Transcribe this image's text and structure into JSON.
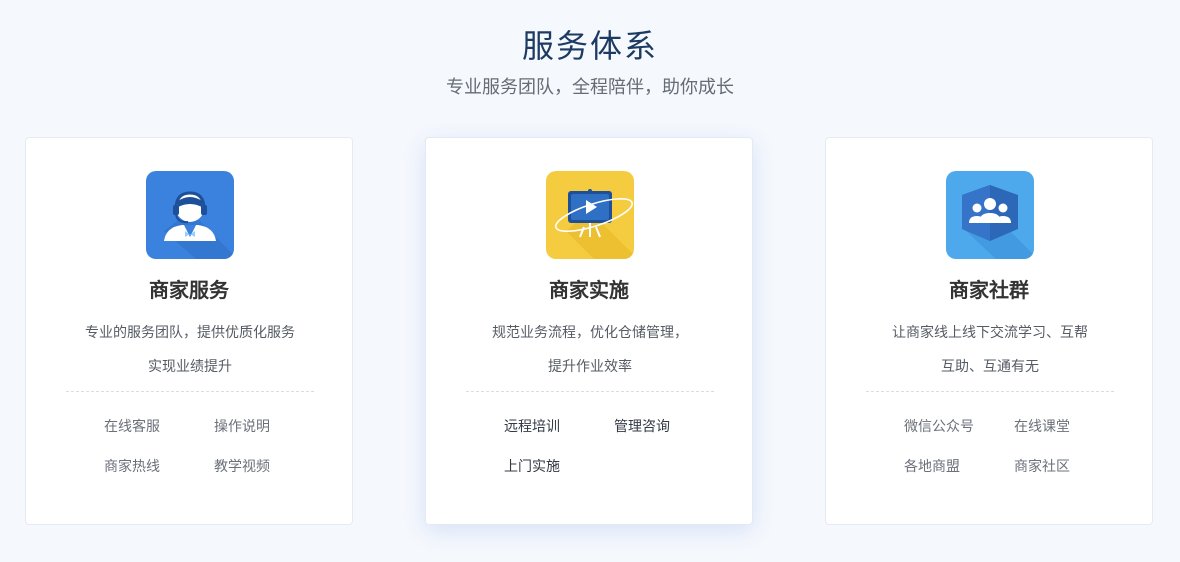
{
  "section": {
    "title": "服务体系",
    "subtitle": "专业服务团队，全程陪伴，助你成长"
  },
  "cards": [
    {
      "icon": "customer-service-headset-icon",
      "icon_color": "#3a82dd",
      "title": "商家服务",
      "desc_line1": "专业的服务团队，提供优质化服务",
      "desc_line2": "实现业绩提升",
      "links": [
        "在线客服",
        "操作说明",
        "商家热线",
        "教学视频"
      ]
    },
    {
      "icon": "training-video-board-icon",
      "icon_color": "#f5cc3f",
      "title": "商家实施",
      "desc_line1": "规范业务流程，优化仓储管理，",
      "desc_line2": "提升作业效率",
      "links": [
        "远程培训",
        "管理咨询",
        "上门实施"
      ]
    },
    {
      "icon": "community-group-icon",
      "icon_color": "#4ea8ec",
      "title": "商家社群",
      "desc_line1": "让商家线上线下交流学习、互帮",
      "desc_line2": "互助、互通有无",
      "links": [
        "微信公众号",
        "在线课堂",
        "各地商盟",
        "商家社区"
      ]
    }
  ]
}
